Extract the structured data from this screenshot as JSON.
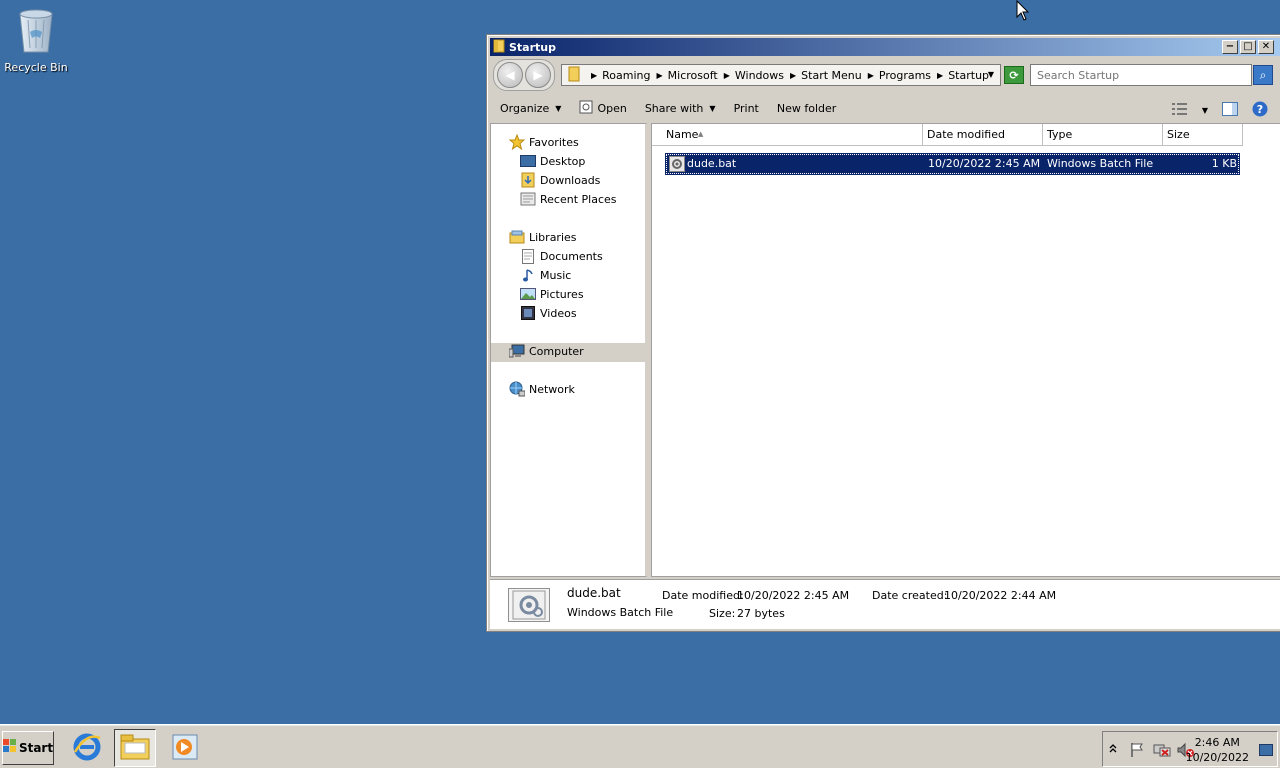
{
  "desktop": {
    "icons": [
      {
        "label": "Recycle Bin",
        "icon": "recycle-bin-icon"
      }
    ]
  },
  "window": {
    "title": "Startup",
    "controls": {
      "minimize": "−",
      "maximize": "□",
      "close": "✕"
    },
    "address": {
      "breadcrumbs": [
        "Roaming",
        "Microsoft",
        "Windows",
        "Start Menu",
        "Programs",
        "Startup"
      ]
    },
    "search": {
      "placeholder": "Search Startup"
    },
    "toolbar": {
      "organize": "Organize",
      "open": "Open",
      "share_with": "Share with",
      "print": "Print",
      "new_folder": "New folder"
    },
    "nav": {
      "favorites": "Favorites",
      "desktop": "Desktop",
      "downloads": "Downloads",
      "recent_places": "Recent Places",
      "libraries": "Libraries",
      "documents": "Documents",
      "music": "Music",
      "pictures": "Pictures",
      "videos": "Videos",
      "computer": "Computer",
      "network": "Network"
    },
    "columns": {
      "name": "Name",
      "date_modified": "Date modified",
      "type": "Type",
      "size": "Size"
    },
    "files": [
      {
        "name": "dude.bat",
        "date_modified": "10/20/2022 2:45 AM",
        "type": "Windows Batch File",
        "size": "1 KB"
      }
    ],
    "details": {
      "name": "dude.bat",
      "type": "Windows Batch File",
      "date_modified_label": "Date modified:",
      "date_modified": "10/20/2022 2:45 AM",
      "size_label": "Size:",
      "size": "27 bytes",
      "date_created_label": "Date created:",
      "date_created": "10/20/2022 2:44 AM"
    }
  },
  "taskbar": {
    "start_label": "Start",
    "clock": {
      "time": "2:46 AM",
      "date": "10/20/2022"
    }
  },
  "colors": {
    "desktop": "#3a6ea5",
    "selection": "#0a246a",
    "title_gradient_start": "#0a246a",
    "title_gradient_end": "#a6caf0"
  }
}
